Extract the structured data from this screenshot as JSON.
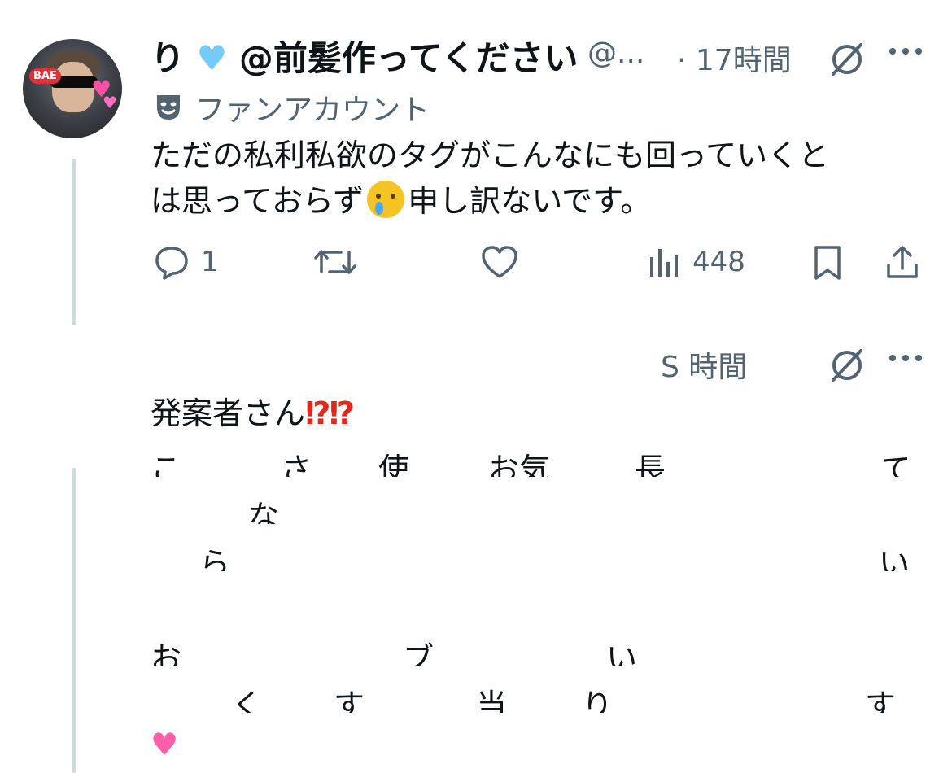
{
  "post1": {
    "display_name": "り",
    "display_name_suffix": "@前髪作ってください",
    "handle": "@...",
    "time": "· 17時間",
    "badge_label": "ファンアカウント",
    "text_line1": "ただの私利私欲のタグがこんなにも回っていくと",
    "text_line2_a": "は思っておらず",
    "text_line2_b": "申し訳ないです。",
    "replies": "1",
    "views": "448"
  },
  "avatar": {
    "badge_text": "BAE"
  },
  "post2": {
    "time": "S 時間",
    "first_line": "発案者さん",
    "first_line_emoji": "⁉⁉",
    "visible_fragments": {
      "line1": [
        "こ",
        "さ",
        "使",
        "お気",
        "長",
        "て"
      ],
      "line2": [
        "な"
      ],
      "line3": [
        "ら",
        "い"
      ],
      "line5": [
        "お",
        "ブ",
        "い"
      ],
      "line6": [
        "く",
        "す",
        "当",
        "り",
        "す"
      ]
    }
  },
  "colors": {
    "text": "#0f1419",
    "muted": "#536471",
    "heart": "#74cbf7",
    "thread_line": "#cfd9de",
    "interrobang": "#e3281b"
  }
}
